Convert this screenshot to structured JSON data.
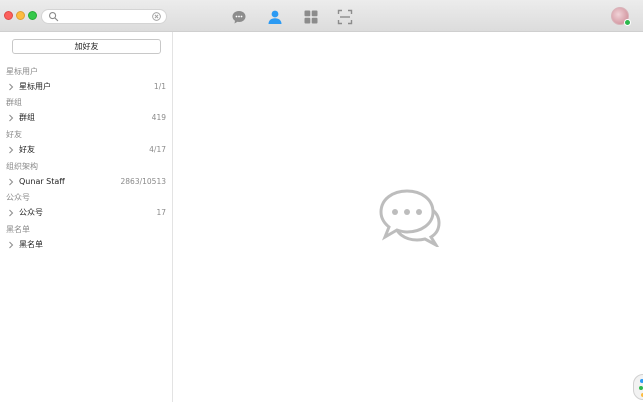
{
  "search": {
    "placeholder": "",
    "value": ""
  },
  "toolbar": {
    "icons": [
      "chat-bubble-icon",
      "contacts-icon",
      "apps-grid-icon",
      "scan-icon"
    ],
    "active_icon": "contacts-icon",
    "active_color": "#2b9af3",
    "inactive_color": "#8c8c8c"
  },
  "sidebar": {
    "add_friend_label": "加好友",
    "sections": [
      {
        "header": "星标用户",
        "label": "星标用户",
        "count": "1/1"
      },
      {
        "header": "群组",
        "label": "群组",
        "count": "419"
      },
      {
        "header": "好友",
        "label": "好友",
        "count": "4/17"
      },
      {
        "header": "组织架构",
        "label": "Qunar Staff",
        "count": "2863/10513"
      },
      {
        "header": "公众号",
        "label": "公众号",
        "count": "17"
      },
      {
        "header": "黑名单",
        "label": "黑名单",
        "count": ""
      }
    ]
  },
  "colors": {
    "close": "#fc605c",
    "minimize": "#fdbc40",
    "maximize": "#34c84a",
    "placeholder_icon": "#bdbdbd"
  }
}
